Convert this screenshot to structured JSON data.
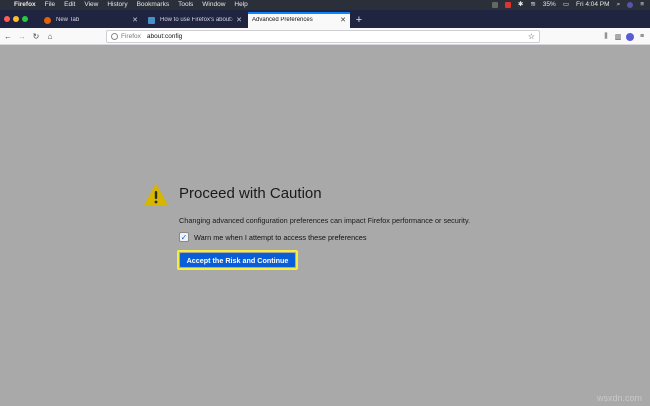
{
  "menubar": {
    "items": [
      "Firefox",
      "File",
      "Edit",
      "View",
      "History",
      "Bookmarks",
      "Tools",
      "Window",
      "Help"
    ],
    "battery": "35%",
    "clock": "Fri 4:04 PM"
  },
  "tabs": [
    {
      "title": "New Tab",
      "active": false
    },
    {
      "title": "How to use Firefox's about:config",
      "active": false
    },
    {
      "title": "Advanced Preferences",
      "active": true
    }
  ],
  "urlbar": {
    "identity": "Firefox",
    "url": "about:config"
  },
  "content": {
    "title": "Proceed with Caution",
    "description": "Changing advanced configuration preferences can impact Firefox performance or security.",
    "checkbox_label": "Warn me when I attempt to access these preferences",
    "checkbox_checked": true,
    "accept_button": "Accept the Risk and Continue"
  },
  "watermark": "wsxdn.com",
  "colors": {
    "accent": "#0a5fd8",
    "highlight": "#f7ee3a",
    "warning": "#d7b600"
  }
}
